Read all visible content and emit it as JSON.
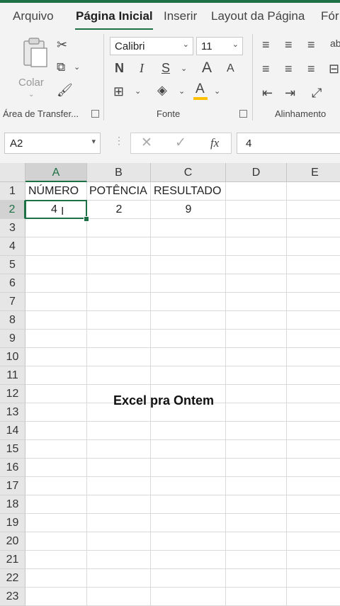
{
  "tabs": [
    "Arquivo",
    "Página Inicial",
    "Inserir",
    "Layout da Página",
    "Fór"
  ],
  "ribbon": {
    "clipboard": {
      "paste_label": "Colar",
      "group_label": "Área de Transfer..."
    },
    "font": {
      "font_name": "Calibri",
      "font_size": "11",
      "bold": "N",
      "italic": "I",
      "underline": "S",
      "grow": "A",
      "shrink": "A",
      "color_a": "A",
      "group_label": "Fonte"
    },
    "alignment": {
      "group_label": "Alinhamento"
    }
  },
  "formula_bar": {
    "name_box": "A2",
    "fx": "fx",
    "content": "4"
  },
  "columns": [
    "A",
    "B",
    "C",
    "D",
    "E"
  ],
  "rows": [
    "1",
    "2",
    "3",
    "4",
    "5",
    "6",
    "7",
    "8",
    "9",
    "10",
    "11",
    "12",
    "13",
    "14",
    "15",
    "16",
    "17",
    "18",
    "19",
    "20",
    "21",
    "22",
    "23"
  ],
  "cells": {
    "A1": "NÚMERO",
    "B1": "POTÊNCIA",
    "C1": "RESULTADO",
    "A2": "4",
    "B2": "2",
    "C2": "9"
  },
  "watermark": "Excel pra Ontem",
  "colors": {
    "accent": "#1e7145",
    "font_color_bar": "#ffc000"
  }
}
